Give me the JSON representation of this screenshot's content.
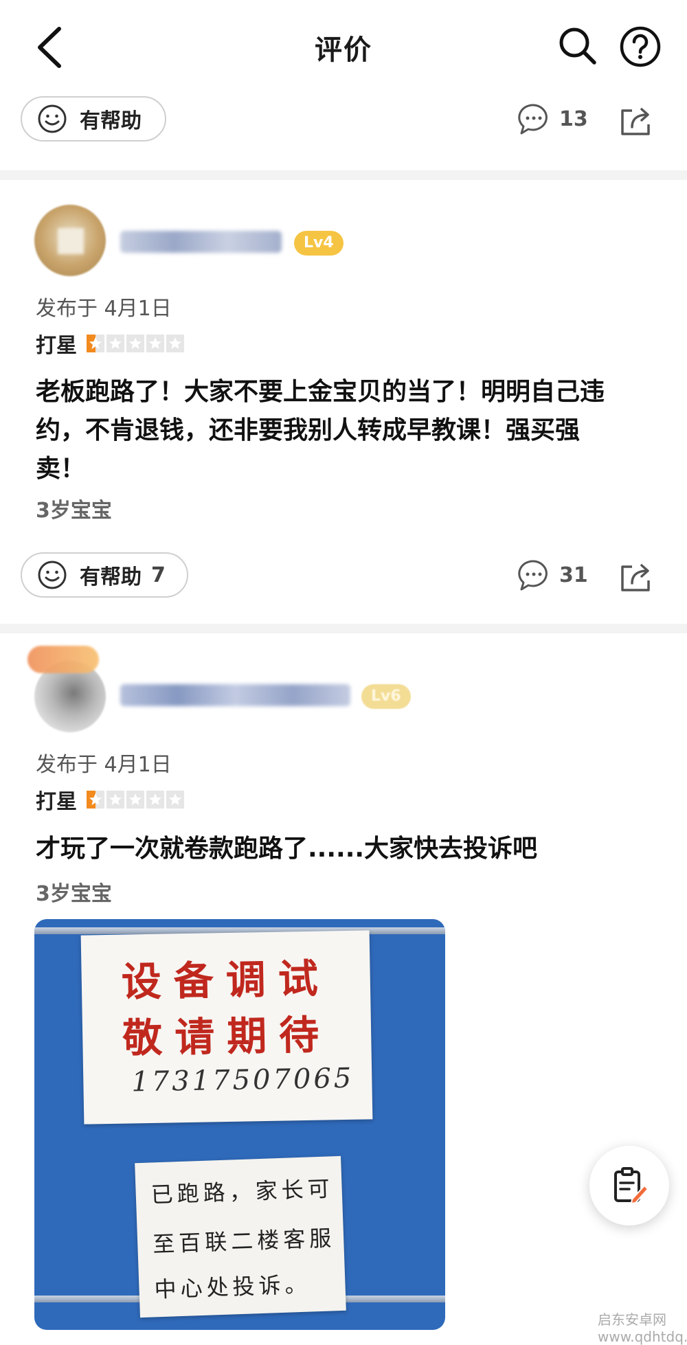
{
  "header": {
    "title": "评价"
  },
  "top_action_bar": {
    "helpful_label": "有帮助",
    "comment_count": "13"
  },
  "reviews": [
    {
      "level": "Lv4",
      "date": "发布于 4月1日",
      "rating_label": "打星",
      "rating": 1,
      "rating_max": 5,
      "text_lines": [
        "老板跑路了！大家不要上金宝贝的当了！明明自己违",
        "约，不肯退钱，还非要我别人转成早教课！强买强",
        "卖！"
      ],
      "tag": "3岁宝宝",
      "helpful_label": "有帮助",
      "helpful_count": "7",
      "comment_count": "31"
    },
    {
      "level": "Lv6",
      "date": "发布于 4月1日",
      "rating_label": "打星",
      "rating": 1,
      "rating_max": 5,
      "text_lines": [
        "才玩了一次就卷款跑路了......大家快去投诉吧"
      ],
      "tag": "3岁宝宝",
      "photo": {
        "sign_top": [
          "设备调试",
          "敬请期待"
        ],
        "sign_top_phone": "17317507065",
        "sign_bottom": [
          "已跑路，家长可",
          "至百联二楼客服",
          "中心处投诉。"
        ]
      }
    }
  ],
  "watermark": "启东安卓网 www.qdhtdq.com",
  "colors": {
    "level_badge": "#f6c443",
    "star_active": "#f28a1e",
    "sign_red": "#c0281e",
    "photo_blue": "#2f69b9"
  }
}
